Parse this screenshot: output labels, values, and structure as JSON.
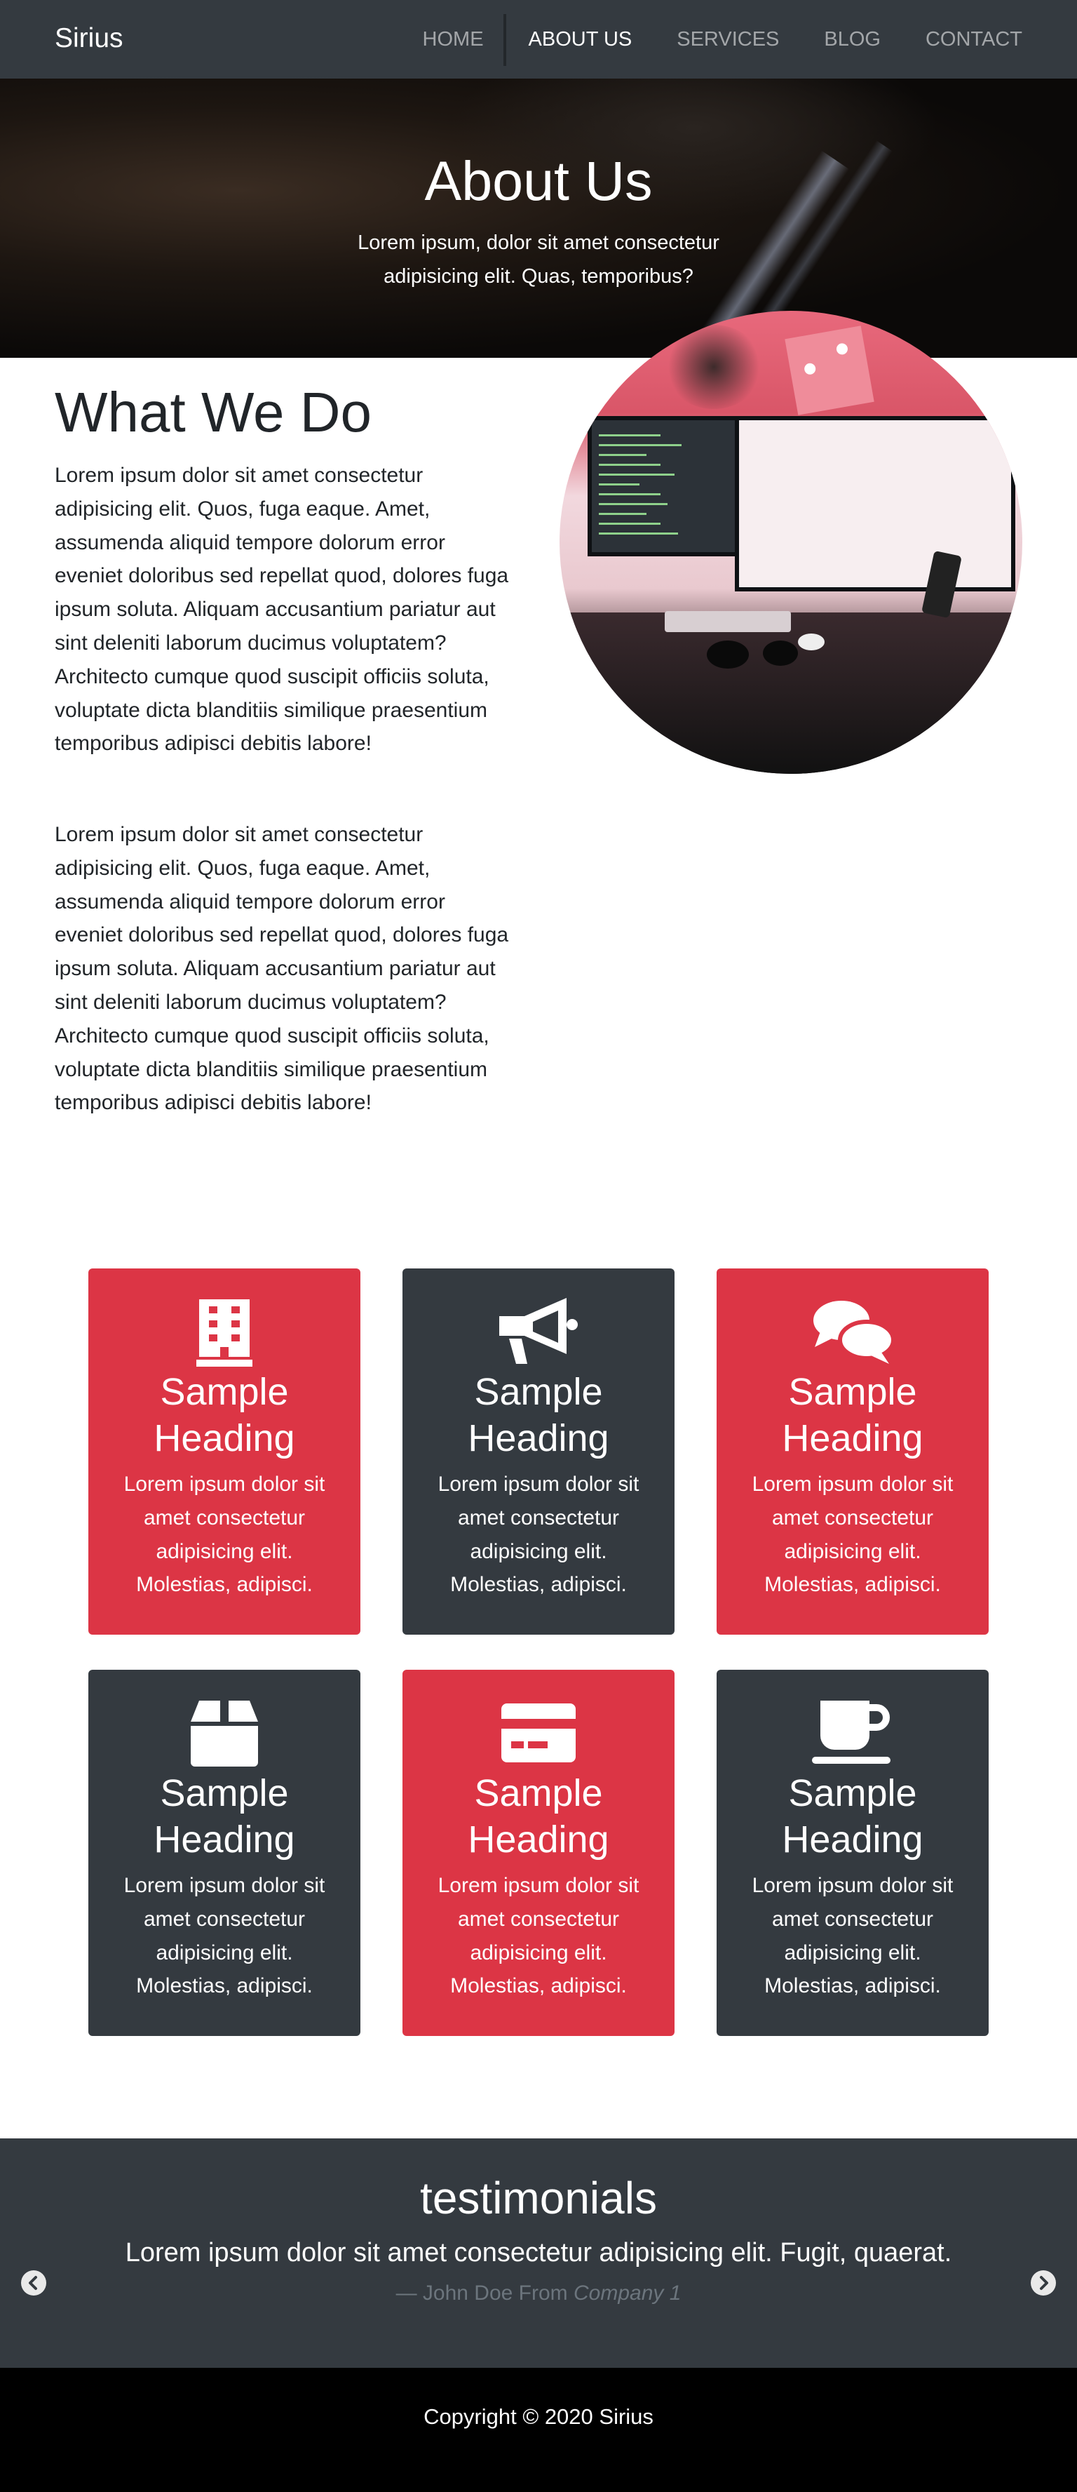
{
  "navbar": {
    "brand": "Sirius",
    "items": [
      {
        "label": "HOME",
        "active": false
      },
      {
        "label": "ABOUT US",
        "active": true
      },
      {
        "label": "SERVICES",
        "active": false
      },
      {
        "label": "BLOG",
        "active": false
      },
      {
        "label": "CONTACT",
        "active": false
      }
    ]
  },
  "hero": {
    "title": "About Us",
    "subtitle": "Lorem ipsum, dolor sit amet consectetur adipisicing elit. Quas, temporibus?"
  },
  "about": {
    "title": "What We Do",
    "paragraphs": [
      "Lorem ipsum dolor sit amet consectetur adipisicing elit. Quos, fuga eaque. Amet, assumenda aliquid tempore dolorum error eveniet doloribus sed repellat quod, dolores fuga ipsum soluta. Aliquam accusantium pariatur aut sint deleniti laborum ducimus voluptatem? Architecto cumque quod suscipit officiis soluta, voluptate dicta blanditiis similique praesentium temporibus adipisci debitis labore!",
      "Lorem ipsum dolor sit amet consectetur adipisicing elit. Quos, fuga eaque. Amet, assumenda aliquid tempore dolorum error eveniet doloribus sed repellat quod, dolores fuga ipsum soluta. Aliquam accusantium pariatur aut sint deleniti laborum ducimus voluptatem? Architecto cumque quod suscipit officiis soluta, voluptate dicta blanditiis similique praesentium temporibus adipisci debitis labore!"
    ]
  },
  "cards": [
    {
      "icon": "building-icon",
      "color": "#dc3545",
      "heading": "Sample Heading",
      "text": "Lorem ipsum dolor sit amet consectetur adipisicing elit. Molestias, adipisci."
    },
    {
      "icon": "megaphone-icon",
      "color": "#343a40",
      "heading": "Sample Heading",
      "text": "Lorem ipsum dolor sit amet consectetur adipisicing elit. Molestias, adipisci."
    },
    {
      "icon": "comments-icon",
      "color": "#dc3545",
      "heading": "Sample Heading",
      "text": "Lorem ipsum dolor sit amet consectetur adipisicing elit. Molestias, adipisci."
    },
    {
      "icon": "box-icon",
      "color": "#343a40",
      "heading": "Sample Heading",
      "text": "Lorem ipsum dolor sit amet consectetur adipisicing elit. Molestias, adipisci."
    },
    {
      "icon": "credit-card-icon",
      "color": "#dc3545",
      "heading": "Sample Heading",
      "text": "Lorem ipsum dolor sit amet consectetur adipisicing elit. Molestias, adipisci."
    },
    {
      "icon": "coffee-cup-icon",
      "color": "#343a40",
      "heading": "Sample Heading",
      "text": "Lorem ipsum dolor sit amet consectetur adipisicing elit. Molestias, adipisci."
    }
  ],
  "testimonials": {
    "title": "testimonials",
    "quote": "Lorem ipsum dolor sit amet consectetur adipisicing elit. Fugit, quaerat.",
    "author_prefix": "— John Doe From ",
    "company": "Company 1"
  },
  "footer": {
    "copyright": "Copyright © 2020 Sirius"
  },
  "colors": {
    "accent": "#dc3545",
    "dark": "#343a40",
    "footer": "#000000"
  }
}
